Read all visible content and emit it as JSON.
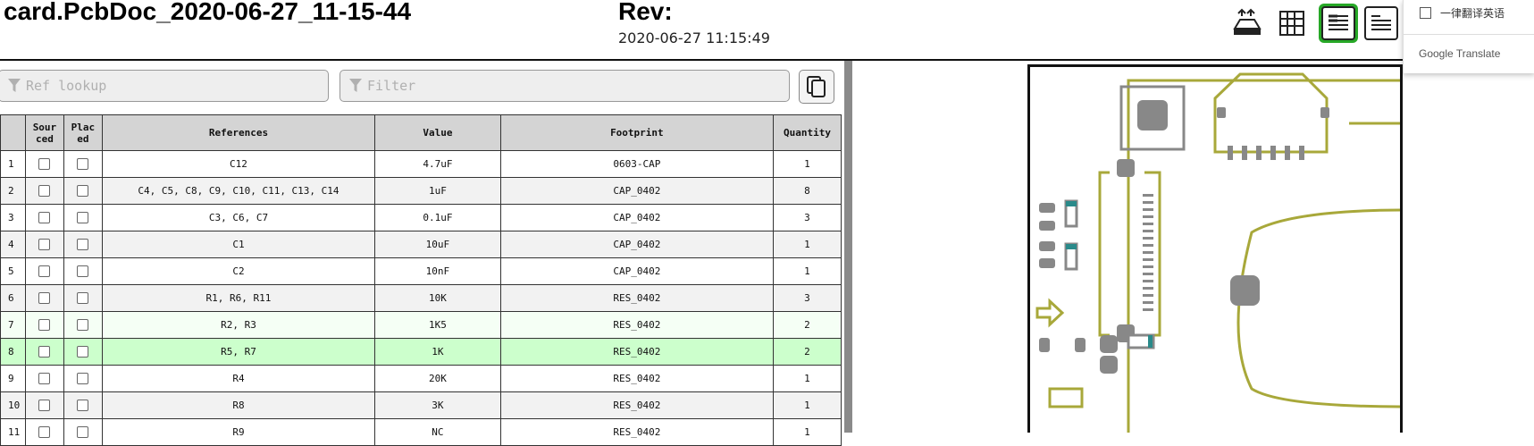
{
  "header": {
    "title": "card.PcbDoc_2020-06-27_11-15-44",
    "rev_label": "Rev:",
    "rev_date": "2020-06-27 11:15:49"
  },
  "toolbar": {
    "icons": [
      "board-top-bottom-icon",
      "grid-icon",
      "bom-left-drawings-right-icon",
      "bom-top-drawings-bottom-icon"
    ],
    "active_color": "#27a827"
  },
  "translate_popup": {
    "option_label": "一律翻译英语",
    "brand": "Google Translate"
  },
  "search": {
    "ref_placeholder": "Ref lookup",
    "filter_placeholder": "Filter"
  },
  "bom": {
    "headers": {
      "sourced": "Sour ced",
      "placed": "Plac ed",
      "references": "References",
      "value": "Value",
      "footprint": "Footprint",
      "quantity": "Quantity"
    },
    "rows": [
      {
        "num": "1",
        "refs": "C12",
        "value": "4.7uF",
        "footprint": "0603-CAP",
        "qty": "1"
      },
      {
        "num": "2",
        "refs": "C4, C5, C8, C9, C10, C11, C13, C14",
        "value": "1uF",
        "footprint": "CAP_0402",
        "qty": "8"
      },
      {
        "num": "3",
        "refs": "C3, C6, C7",
        "value": "0.1uF",
        "footprint": "CAP_0402",
        "qty": "3"
      },
      {
        "num": "4",
        "refs": "C1",
        "value": "10uF",
        "footprint": "CAP_0402",
        "qty": "1"
      },
      {
        "num": "5",
        "refs": "C2",
        "value": "10nF",
        "footprint": "CAP_0402",
        "qty": "1"
      },
      {
        "num": "6",
        "refs": "R1, R6, R11",
        "value": "10K",
        "footprint": "RES_0402",
        "qty": "3"
      },
      {
        "num": "7",
        "refs": "R2, R3",
        "value": "1K5",
        "footprint": "RES_0402",
        "qty": "2"
      },
      {
        "num": "8",
        "refs": "R5, R7",
        "value": "1K",
        "footprint": "RES_0402",
        "qty": "2"
      },
      {
        "num": "9",
        "refs": "R4",
        "value": "20K",
        "footprint": "RES_0402",
        "qty": "1"
      },
      {
        "num": "10",
        "refs": "R8",
        "value": "3K",
        "footprint": "RES_0402",
        "qty": "1"
      },
      {
        "num": "11",
        "refs": "R9",
        "value": "NC",
        "footprint": "RES_0402",
        "qty": "1"
      }
    ],
    "highlight_color": "#ccffcc"
  },
  "pcb": {
    "silk_color": "#a8a83a",
    "pad_color": "#888888"
  }
}
